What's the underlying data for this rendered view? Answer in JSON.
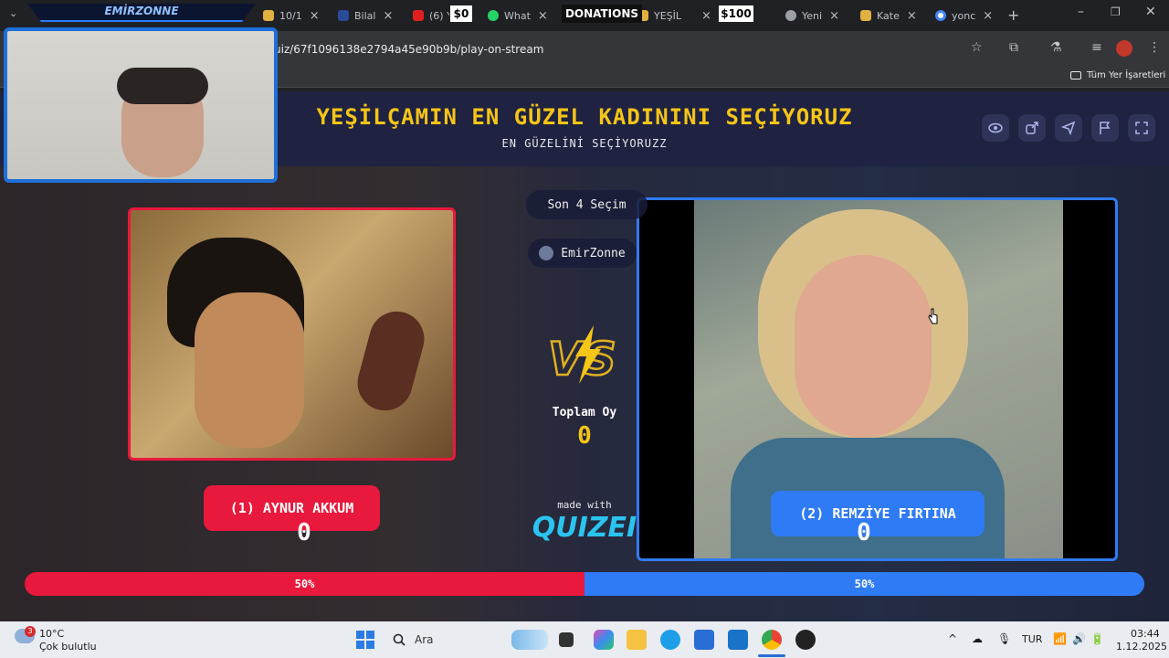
{
  "browser": {
    "tabs": [
      {
        "label": "10/1",
        "color": "#e0b040"
      },
      {
        "label": "Bilal",
        "color": "#2a4a9a"
      },
      {
        "label": "(6) Y",
        "color": "#e02020"
      },
      {
        "label": "What",
        "color": "#25d366"
      },
      {
        "label": "YEŞİL",
        "color": "#e0b040"
      },
      {
        "label": "Yeni",
        "color": "#9aa0a6"
      },
      {
        "label": "Kate",
        "color": "#e0b040"
      },
      {
        "label": "yonc",
        "color": "#4285f4"
      }
    ],
    "url": "uiz/67f1096138e2794a45e90b9b/play-on-stream",
    "bookmarks_label": "Tüm Yer İşaretleri"
  },
  "overlay": {
    "cam_title": "EMİRZONNE",
    "donation_left": "$0",
    "donation_title": "DONATIONS",
    "donation_right": "$100"
  },
  "quiz": {
    "title": "YEŞİLÇAMIN EN GÜZEL KADININI SEÇİYORUZ",
    "subtitle": "EN GÜZELİNİ SEÇİYORUZZ",
    "recent_label": "Son 4 Seçim",
    "user": "EmirZonne",
    "vs_label": "VS",
    "total_label": "Toplam Oy",
    "total_votes": "0",
    "made_with": "made with",
    "brand": "QUIZEI",
    "left": {
      "label": "(1) AYNUR AKKUM",
      "votes": "0",
      "percent_text": "50%",
      "percent": 50,
      "color": "#e8193c"
    },
    "right": {
      "label": "(2) REMZİYE FIRTINA",
      "votes": "0",
      "percent_text": "50%",
      "percent": 50,
      "color": "#2f7bf5"
    }
  },
  "taskbar": {
    "temp": "10°C",
    "weather": "Çok bulutlu",
    "badge": "3",
    "search": "Ara",
    "lang": "TUR",
    "time": "03:44",
    "date": "1.12.2025"
  }
}
